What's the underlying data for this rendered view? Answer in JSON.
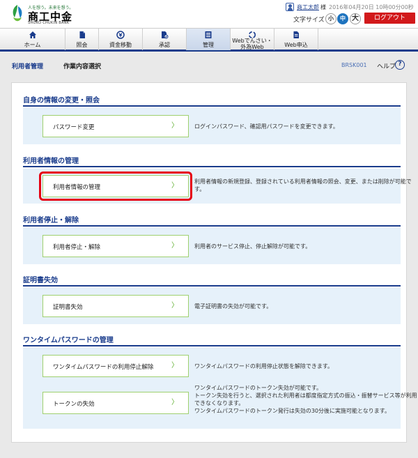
{
  "header": {
    "logo_tagline": "人を想う。未来を想う。",
    "logo_name": "商工中金",
    "logo_en": "SHOKO CHUKIN BANK",
    "user_name": "商工太郎",
    "user_honorific": "様",
    "login_time": "2016年04月20日 10時00分00秒",
    "fontsize_label": "文字サイズ",
    "fontsize_small": "小",
    "fontsize_mid": "中",
    "fontsize_large": "大",
    "logout_label": "ログアウト",
    "colors": {
      "logout": "#d2191b",
      "brand_blue": "#1a3c8c",
      "font_active": "#1e73be"
    }
  },
  "nav": {
    "items": [
      {
        "label": "ホーム",
        "icon": "home-icon"
      },
      {
        "label": "照会",
        "icon": "document-icon"
      },
      {
        "label": "資金移動",
        "icon": "money-transfer-icon"
      },
      {
        "label": "承認",
        "icon": "approval-icon"
      },
      {
        "label": "管理",
        "icon": "management-icon",
        "active": true
      },
      {
        "label_line1": "Webでんさい・",
        "label_line2": "外為Web",
        "icon": "refresh-icon"
      },
      {
        "label": "Web申込",
        "icon": "application-icon"
      }
    ]
  },
  "page": {
    "title": "利用者管理",
    "subtitle": "作業内容選択",
    "screen_code": "BRSK001",
    "help_label": "ヘルプ",
    "help_icon_text": "?"
  },
  "sections": [
    {
      "title": "自身の情報の変更・照会",
      "rows": [
        {
          "button": "パスワード変更",
          "desc": [
            "ログインパスワード、確認用パスワードを変更できます。"
          ]
        }
      ]
    },
    {
      "title": "利用者情報の管理",
      "rows": [
        {
          "button": "利用者情報の管理",
          "highlight": true,
          "desc": [
            "利用者情報の新規登録、登録されている利用者情報の照会、変更、または削除が可能で",
            "す。"
          ]
        }
      ]
    },
    {
      "title": "利用者停止・解除",
      "rows": [
        {
          "button": "利用者停止・解除",
          "desc": [
            "利用者のサービス停止、停止解除が可能です。"
          ]
        }
      ]
    },
    {
      "title": "証明書失効",
      "rows": [
        {
          "button": "証明書失効",
          "desc": [
            "電子証明書の失効が可能です。"
          ]
        }
      ]
    },
    {
      "title": "ワンタイムパスワードの管理",
      "rows": [
        {
          "button": "ワンタイムパスワードの利用停止解除",
          "desc": [
            "ワンタイムパスワードの利用停止状態を解除できます。"
          ]
        },
        {
          "button": "トークンの失効",
          "desc": [
            "ワンタイムパスワードのトークン失効が可能です。",
            "トークン失効を行うと、選択された利用者は都度指定方式の振込・振替サービス等が利用",
            "できなくなります。",
            "ワンタイムパスワードのトークン発行は失効の30分後に実施可能となります。"
          ]
        }
      ]
    }
  ],
  "chevron_glyph": "〉"
}
